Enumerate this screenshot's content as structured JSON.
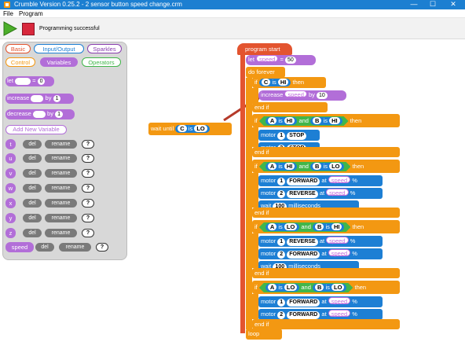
{
  "window": {
    "title": "Crumble Version 0.25.2 - 2 sensor button speed change.crm",
    "minimize": "—",
    "maximize": "☐",
    "close": "✕"
  },
  "menu": {
    "file": "File",
    "program": "Program"
  },
  "toolbar": {
    "status": "Programming successful"
  },
  "palette": {
    "categories": {
      "basic": "Basic",
      "io": "Input/Output",
      "sparkles": "Sparkles",
      "control": "Control",
      "variables": "Variables",
      "operators": "Operators"
    },
    "let_label": "let",
    "let_value": "0",
    "increase_label": "increase",
    "by": "by",
    "increase_value": "1",
    "decrease_label": "decrease",
    "decrease_value": "1",
    "add_variable": "Add New Variable",
    "del": "del",
    "rename": "rename",
    "q": "?",
    "vars": [
      "t",
      "u",
      "v",
      "w",
      "x",
      "y",
      "z",
      "speed"
    ]
  },
  "wait_block": {
    "label": "wait until",
    "sensor": "C",
    "is": "is",
    "state": "LO"
  },
  "program": {
    "start": "program start",
    "let": "let",
    "speed": "speed",
    "eq": "=",
    "speed_value": "50",
    "do_forever": "do forever",
    "if": "if",
    "then": "then",
    "end_if": "end if",
    "loop": "loop",
    "is": "is",
    "and": "and",
    "c": "C",
    "a": "A",
    "b": "B",
    "hi": "HI",
    "lo": "LO",
    "increase": "increase",
    "by": "by",
    "incr_value": "10",
    "motor": "motor",
    "m1": "1",
    "m2": "2",
    "stop": "STOP",
    "forward": "FORWARD",
    "reverse": "REVERSE",
    "at": "at",
    "pct": "%",
    "wait": "wait",
    "wait_value": "100",
    "ms": "milliseconds"
  },
  "colors": {
    "titlebar": "#1c7fd1",
    "control": "#f39812",
    "io": "#1d7fd4",
    "variables": "#b26ed8",
    "operators": "#41b64a",
    "arrow": "#b53a2a"
  }
}
